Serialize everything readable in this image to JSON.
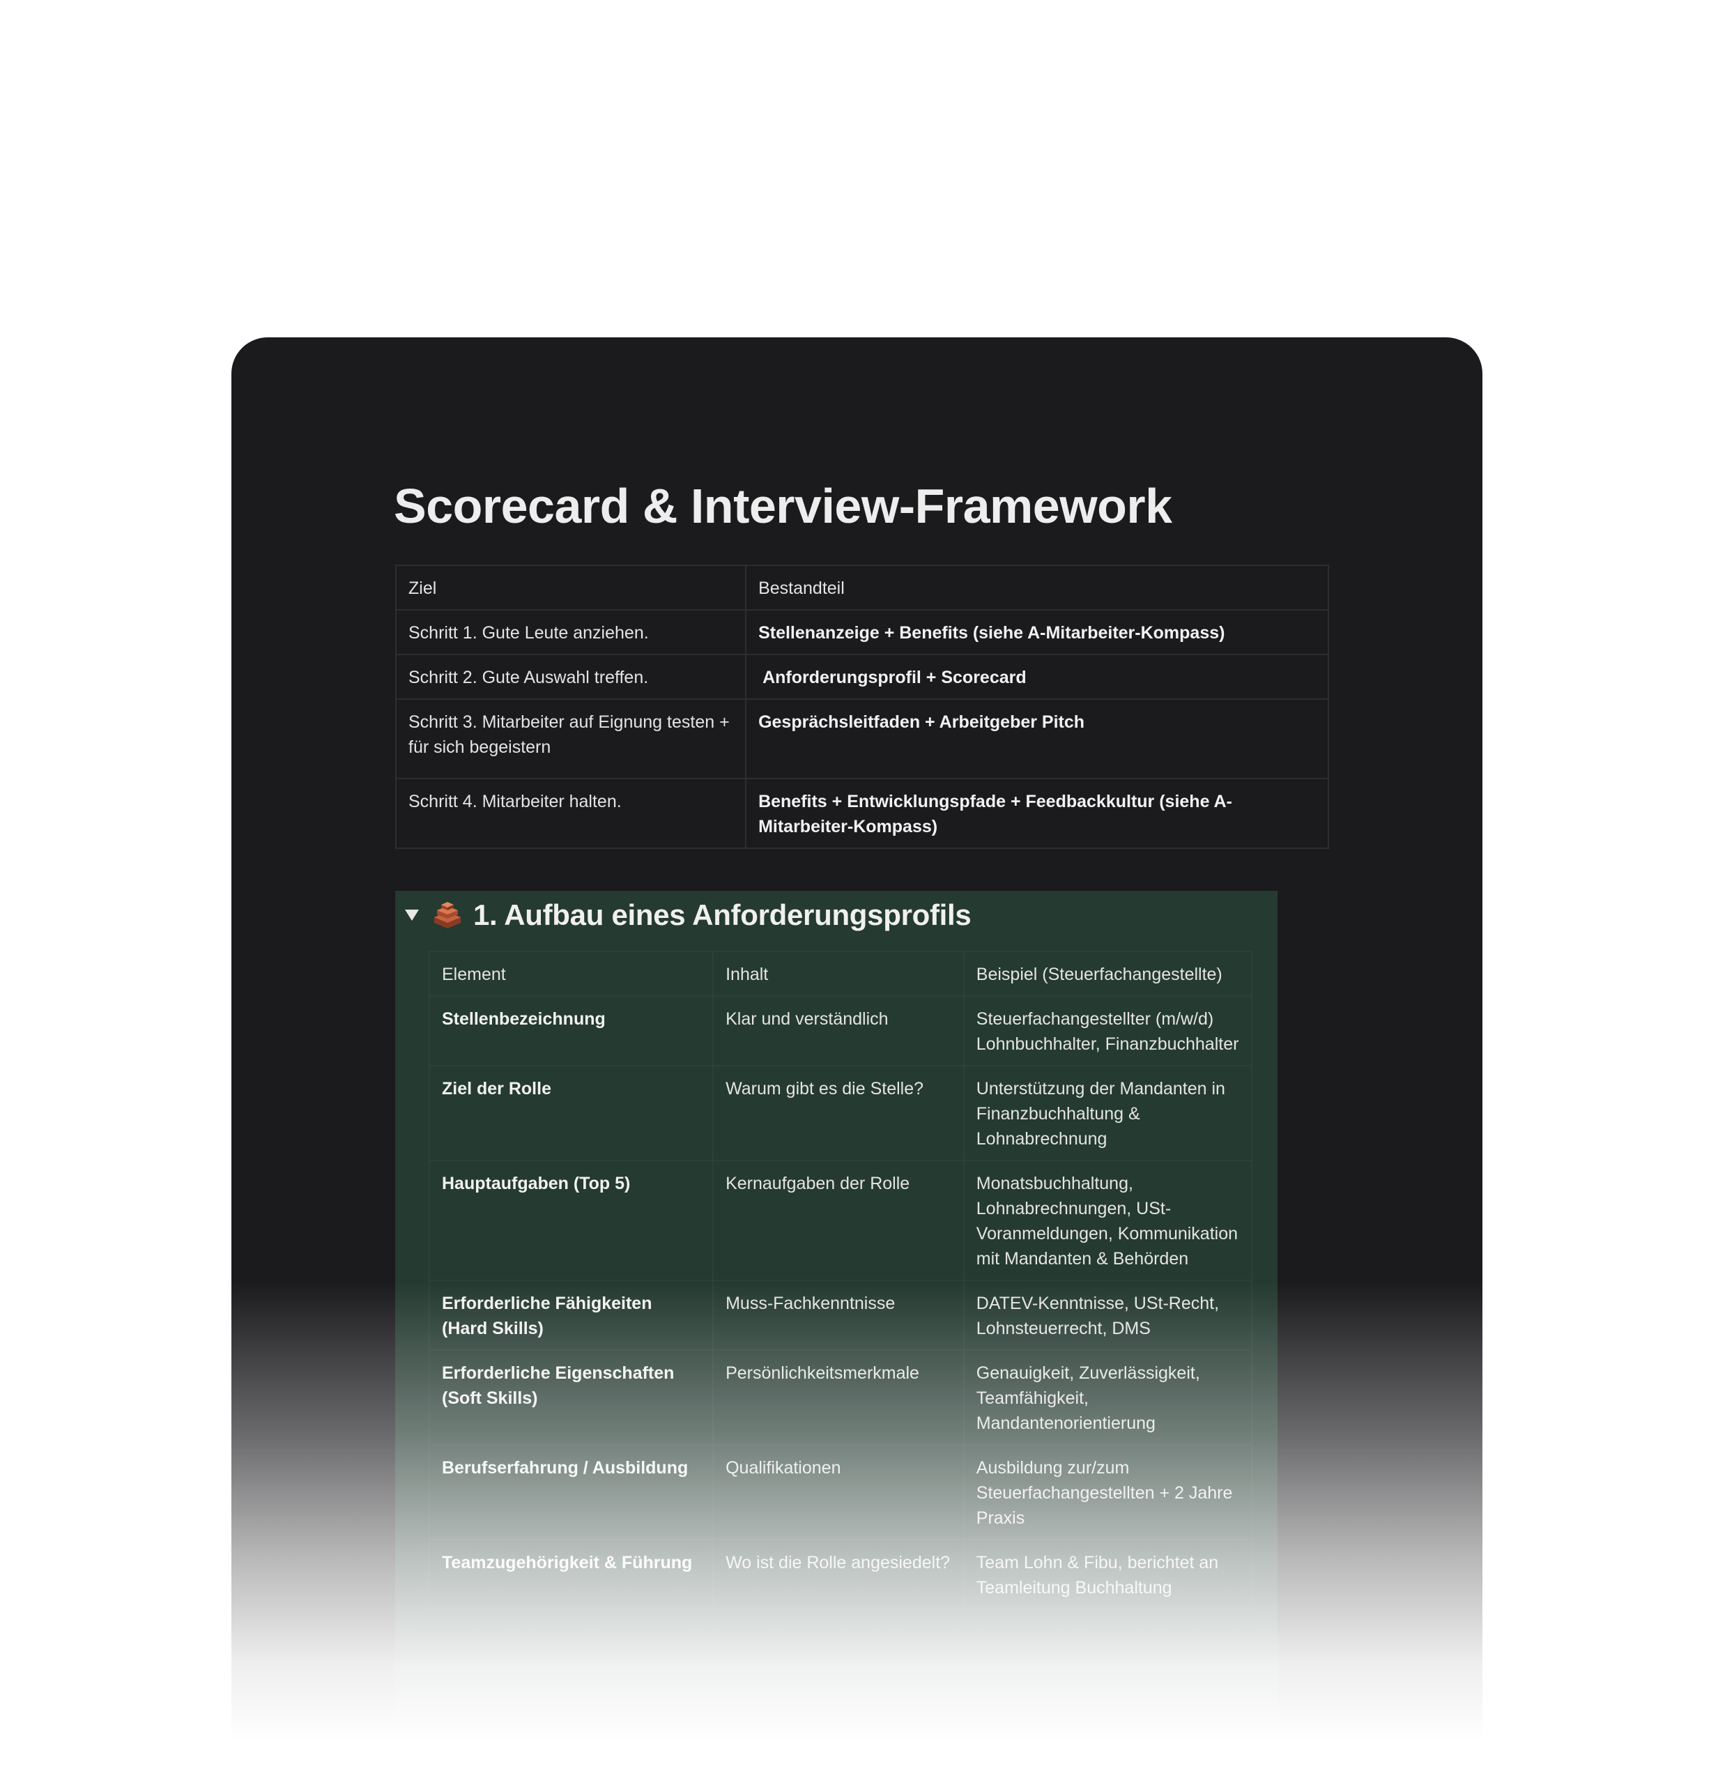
{
  "page": {
    "title": "Scorecard & Interview-Framework"
  },
  "overview_table": {
    "headers": [
      "Ziel",
      "Bestandteil"
    ],
    "rows": [
      [
        "Schritt 1. Gute Leute anziehen.",
        "Stellenanzeige + Benefits (siehe A-Mitarbeiter-Kompass)"
      ],
      [
        "Schritt 2. Gute Auswahl treffen.",
        " Anforderungsprofil + Scorecard"
      ],
      [
        "Schritt 3. Mitarbeiter auf Eignung testen + für sich begeistern",
        "Gesprächsleitfaden + Arbeitgeber Pitch"
      ],
      [
        "Schritt 4. Mitarbeiter halten.",
        "Benefits + Entwicklungspfade + Feedbackkultur (siehe A-Mitarbeiter-Kompass)"
      ]
    ]
  },
  "toggle_section": {
    "icon": "brick-icon",
    "title": "1. Aufbau eines Anforderungsprofils",
    "expanded": true,
    "background_color": "#253a31",
    "table": {
      "headers": [
        "Element",
        "Inhalt",
        "Beispiel (Steuerfachangestellte)"
      ],
      "rows": [
        [
          "Stellenbezeichnung",
          "Klar und verständlich",
          "Steuerfachangestellter (m/w/d) Lohnbuchhalter, Finanzbuchhalter"
        ],
        [
          "Ziel der Rolle",
          "Warum gibt es die Stelle?",
          "Unterstützung der Mandanten in Finanzbuchhaltung & Lohnabrechnung"
        ],
        [
          "Hauptaufgaben (Top 5)",
          "Kernaufgaben der Rolle",
          "Monatsbuchhaltung, Lohnabrechnungen, USt-Voranmeldungen, Kommunikation mit Mandanten & Behörden"
        ],
        [
          "Erforderliche Fähigkeiten (Hard Skills)",
          "Muss-Fachkenntnisse",
          "DATEV-Kenntnisse, USt-Recht, Lohnsteuerrecht, DMS"
        ],
        [
          "Erforderliche Eigenschaften (Soft Skills)",
          "Persönlichkeitsmerkmale",
          "Genauigkeit, Zuverlässigkeit, Teamfähigkeit, Mandantenorientierung"
        ],
        [
          "Berufserfahrung / Ausbildung",
          "Qualifikationen",
          "Ausbildung zur/zum Steuerfachangestellten + 2 Jahre Praxis"
        ],
        [
          "Teamzugehörigkeit & Führung",
          "Wo ist die Rolle angesiedelt?",
          "Team Lohn & Fibu, berichtet an Teamleitung Buchhaltung"
        ]
      ]
    }
  },
  "colors": {
    "card_background": "#1b1a1d",
    "text": "#e4e4e4",
    "toggle_background": "#253a31"
  }
}
